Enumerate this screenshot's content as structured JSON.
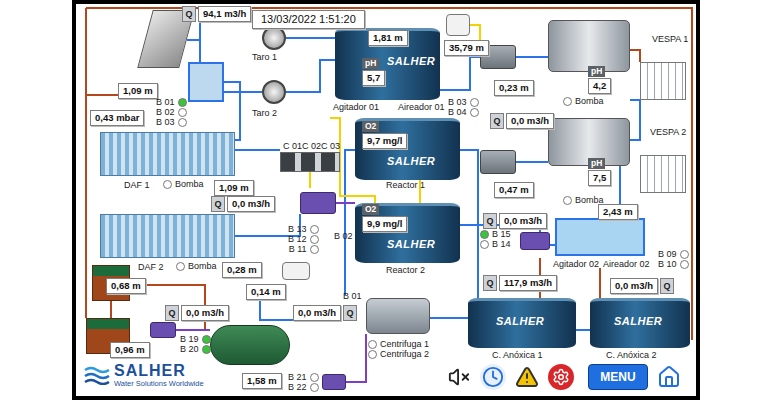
{
  "header": {
    "datetime": "13/03/2022 1:51:20"
  },
  "flows": [
    {
      "badge": "Q",
      "value": "94,1 m3/h"
    },
    {
      "badge": "Q",
      "value": "0,0 m3/h"
    },
    {
      "badge": "Q",
      "value": "0,0 m3/h"
    },
    {
      "badge": "Q",
      "value": "0,0 m3/h"
    },
    {
      "badge": "Q",
      "value": "117,9 m3/h"
    },
    {
      "badge": "Q",
      "value": "0,0 m3/h"
    },
    {
      "badge": "Q",
      "value": "0,0 m3/h"
    },
    {
      "badge": "Q",
      "value": "0,0 m3/h"
    }
  ],
  "levels": [
    "1,81 m",
    "1,09 m",
    "0,43 mbar",
    "35,79 m",
    "0,23 m",
    "0,47 m",
    "2,43 m",
    "1,09 m",
    "0,28 m",
    "0,68 m",
    "0,14 m",
    "0,96 m",
    "1,58 m"
  ],
  "sensors": [
    {
      "label": "pH",
      "value": "5,7"
    },
    {
      "label": "O2",
      "value": "9,7 mg/l"
    },
    {
      "label": "O2",
      "value": "9,9 mg/l"
    },
    {
      "label": "pH",
      "value": "4,2"
    },
    {
      "label": "pH",
      "value": "7,5"
    }
  ],
  "pump_groups": [
    {
      "items": [
        {
          "label": "B 01",
          "on": true
        },
        {
          "label": "B 02",
          "on": false
        },
        {
          "label": "B 03",
          "on": false
        }
      ]
    },
    {
      "items": [
        {
          "label": "B 03",
          "on": false
        },
        {
          "label": "B 04",
          "on": false
        }
      ]
    },
    {
      "items": [
        {
          "label": "B 13",
          "on": false
        },
        {
          "label": "B 12",
          "on": false
        },
        {
          "label": "B 11",
          "on": false
        }
      ]
    },
    {
      "items": [
        {
          "label": "B 15",
          "on": true
        },
        {
          "label": "B 14",
          "on": false
        }
      ]
    },
    {
      "items": [
        {
          "label": "B 09",
          "on": false
        },
        {
          "label": "B 10",
          "on": false
        }
      ]
    },
    {
      "items": [
        {
          "label": "B 19",
          "on": true
        },
        {
          "label": "B 20",
          "on": true
        }
      ]
    },
    {
      "items": [
        {
          "label": "B 21",
          "on": false
        },
        {
          "label": "B 22",
          "on": false
        }
      ]
    },
    {
      "items": [
        {
          "label": "Centrifuga 1",
          "on": false
        },
        {
          "label": "Centrifuga 2",
          "on": false
        }
      ]
    },
    {
      "items": [
        {
          "label": "Bomba",
          "on": false
        }
      ]
    },
    {
      "items": [
        {
          "label": "Bomba",
          "on": false
        }
      ]
    },
    {
      "items": [
        {
          "label": "Bomba",
          "on": false
        }
      ]
    },
    {
      "items": [
        {
          "label": "Bomba",
          "on": false
        }
      ]
    }
  ],
  "labels": [
    "Taro 1",
    "Taro 2",
    "Agitador 01",
    "Aireador 01",
    "VESPA 1",
    "VESPA 2",
    "Agitador 02",
    "Aireador 02",
    "C 01",
    "C 02",
    "C 03",
    "B 02",
    "B 01",
    "Reactor 1",
    "Reactor 2",
    "C. Anóxica 1",
    "C. Anóxica 2",
    "DAF 1",
    "DAF 2"
  ],
  "tanks": [
    {
      "brand": "SALHER"
    },
    {
      "brand": "SALHER"
    },
    {
      "brand": "SALHER"
    },
    {
      "brand": "SALHER"
    },
    {
      "brand": "SALHER"
    }
  ],
  "logo": {
    "name": "SALHER",
    "tagline": "Water Solutions Worldwide"
  },
  "toolbar": {
    "menu": "MENU"
  }
}
